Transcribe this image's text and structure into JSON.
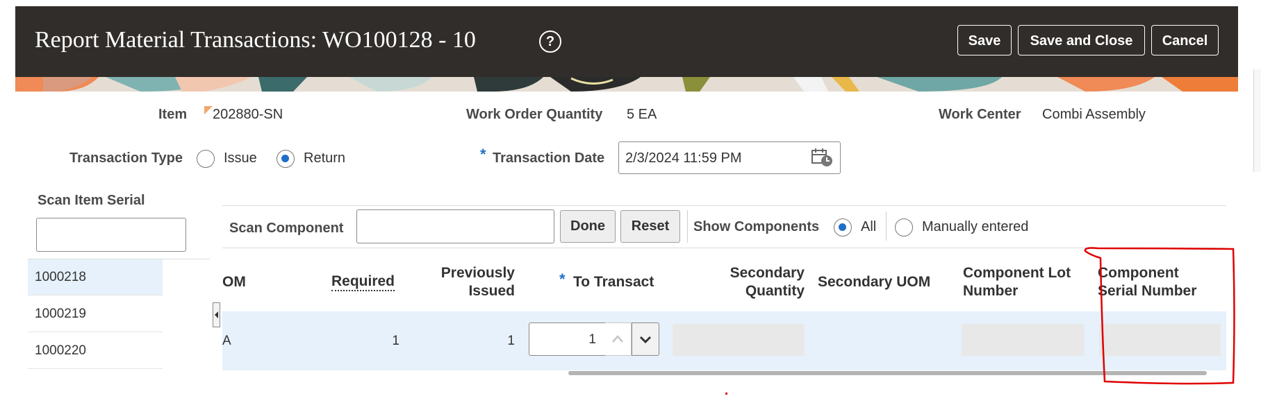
{
  "header": {
    "title": "Report Material Transactions: WO100128 - 10",
    "save_label": "Save",
    "save_close_label": "Save and Close",
    "cancel_label": "Cancel",
    "help_glyph": "?"
  },
  "details": {
    "item_label": "Item",
    "item_value": "202880-SN",
    "woq_label": "Work Order Quantity",
    "woq_value": "5 EA",
    "wc_label": "Work Center",
    "wc_value": "Combi Assembly",
    "tt_label": "Transaction Type",
    "tt_options": [
      "Issue",
      "Return"
    ],
    "tt_selected": "Return",
    "td_label": "Transaction Date",
    "td_value": "2/3/2024 11:59 PM",
    "required_mark": "*"
  },
  "serials": {
    "label": "Scan Item Serial",
    "input_value": "",
    "items": [
      "1000218",
      "1000219",
      "1000220"
    ],
    "selected": "1000218"
  },
  "components": {
    "scan_label": "Scan Component",
    "scan_value": "",
    "done_label": "Done",
    "reset_label": "Reset",
    "show_label": "Show Components",
    "show_options": [
      "All",
      "Manually entered"
    ],
    "show_selected": "All",
    "columns": {
      "uom": "OM",
      "required": "Required",
      "prev_line1": "Previously",
      "prev_line2": "Issued",
      "to_transact": "To Transact",
      "sec_qty_line1": "Secondary",
      "sec_qty_line2": "Quantity",
      "sec_uom": "Secondary UOM",
      "lot_line1": "Component Lot",
      "lot_line2": "Number",
      "serial_line1": "Component",
      "serial_line2": "Serial Number"
    },
    "row": {
      "uom": "A",
      "required": "1",
      "previously_issued": "1",
      "to_transact": "1",
      "secondary_quantity": "",
      "secondary_uom": "",
      "lot": "",
      "serial": ""
    }
  },
  "colors": {
    "header_bg": "#312d2a",
    "accent": "#1f6fc9",
    "selected_row": "#e6f1fb",
    "annotation": "#e00000"
  }
}
